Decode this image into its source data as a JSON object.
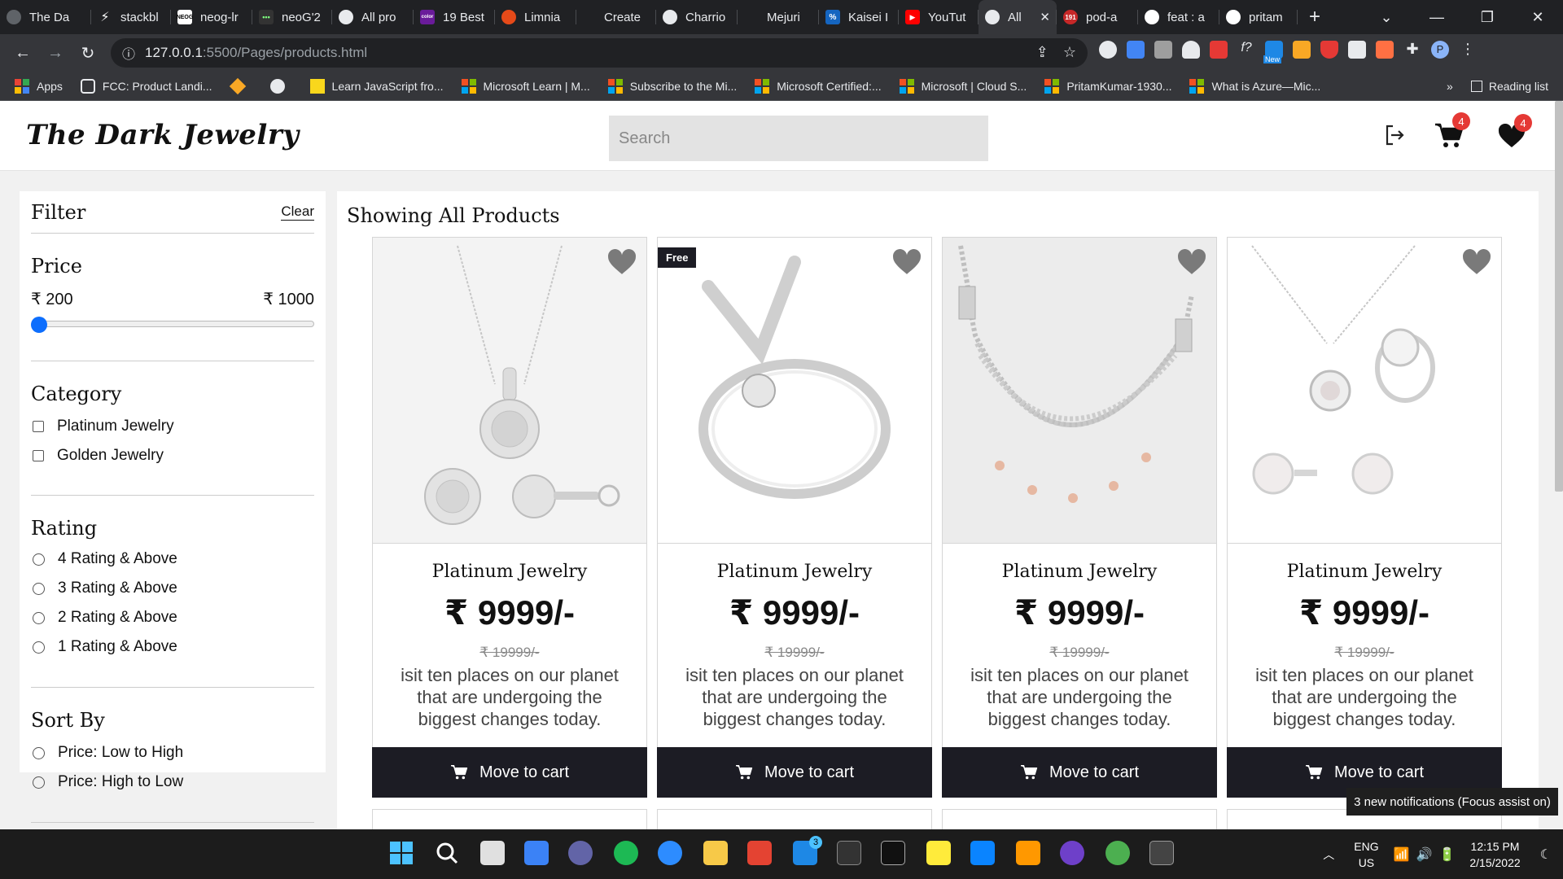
{
  "browser": {
    "tabs": [
      {
        "label": "The Da",
        "color": "#5f6368"
      },
      {
        "label": "stackbl",
        "color": "#3367d6"
      },
      {
        "label": "neog-lr",
        "color": "#111111"
      },
      {
        "label": "neoG'2",
        "color": "#444444"
      },
      {
        "label": "All pro",
        "color": "#5f6368"
      },
      {
        "label": "19 Best",
        "color": "#6a1b9a"
      },
      {
        "label": "Limnia",
        "color": "#e64a19"
      },
      {
        "label": "Create",
        "color": "#202124"
      },
      {
        "label": "Charrio",
        "color": "#5f6368"
      },
      {
        "label": "Mejuri",
        "color": "#202124"
      },
      {
        "label": "Kaisei I",
        "color": "#1565c0"
      },
      {
        "label": "YouTut",
        "color": "#ff0000"
      },
      {
        "label": "All",
        "color": "#5f6368",
        "active": true
      },
      {
        "label": "pod-a",
        "color": "#c62828"
      },
      {
        "label": "feat : a",
        "color": "#ffffff"
      },
      {
        "label": "pritam",
        "color": "#ffffff"
      }
    ],
    "url_host": "127.0.0.1",
    "url_path": ":5500/Pages/products.html",
    "bookmarks": [
      {
        "label": "Apps",
        "type": "apps"
      },
      {
        "label": "FCC: Product Landi...",
        "type": "fcc"
      },
      {
        "label": "",
        "type": "diamond"
      },
      {
        "label": "",
        "type": "globe"
      },
      {
        "label": "Learn JavaScript fro...",
        "type": "js"
      },
      {
        "label": "Microsoft Learn | M...",
        "type": "ms"
      },
      {
        "label": "Subscribe to the Mi...",
        "type": "ms"
      },
      {
        "label": "Microsoft Certified:...",
        "type": "ms"
      },
      {
        "label": "Microsoft | Cloud S...",
        "type": "ms"
      },
      {
        "label": "PritamKumar-1930...",
        "type": "ms"
      },
      {
        "label": "What is Azure—Mic...",
        "type": "ms"
      }
    ],
    "reading_list": "Reading list",
    "new_badge": "New",
    "profile_initial": "P"
  },
  "site": {
    "logo": "The Dark Jewelry",
    "search_placeholder": "Search",
    "cart_count": "4",
    "wishlist_count": "4"
  },
  "filter": {
    "title": "Filter",
    "clear": "Clear",
    "price_heading": "Price",
    "price_min": "₹ 200",
    "price_max": "₹ 1000",
    "price_slider_value": 200,
    "category_heading": "Category",
    "categories": [
      "Platinum Jewelry",
      "Golden Jewelry"
    ],
    "rating_heading": "Rating",
    "ratings": [
      "4 Rating & Above",
      "3 Rating & Above",
      "2 Rating & Above",
      "1 Rating & Above"
    ],
    "sort_heading": "Sort By",
    "sorts": [
      "Price: Low to High",
      "Price: High to Low"
    ]
  },
  "products": {
    "heading": "Showing All Products",
    "items": [
      {
        "name": "Platinum Jewelry",
        "price": "₹ 9999/-",
        "old_price": "₹ 19999/-",
        "desc": "isit ten places on our planet that are undergoing the biggest changes today.",
        "button": "Move to cart",
        "badge": ""
      },
      {
        "name": "Platinum Jewelry",
        "price": "₹ 9999/-",
        "old_price": "₹ 19999/-",
        "desc": "isit ten places on our planet that are undergoing the biggest changes today.",
        "button": "Move to cart",
        "badge": "Free"
      },
      {
        "name": "Platinum Jewelry",
        "price": "₹ 9999/-",
        "old_price": "₹ 19999/-",
        "desc": "isit ten places on our planet that are undergoing the biggest changes today.",
        "button": "Move to cart",
        "badge": ""
      },
      {
        "name": "Platinum Jewelry",
        "price": "₹ 9999/-",
        "old_price": "₹ 19999/-",
        "desc": "isit ten places on our planet that are undergoing the biggest changes today.",
        "button": "Move to cart",
        "badge": ""
      }
    ]
  },
  "notification": "3 new notifications (Focus assist on)",
  "taskbar": {
    "lang": "ENG",
    "region": "US",
    "time": "12:15 PM",
    "date": "2/15/2022",
    "mail_badge": "3"
  }
}
